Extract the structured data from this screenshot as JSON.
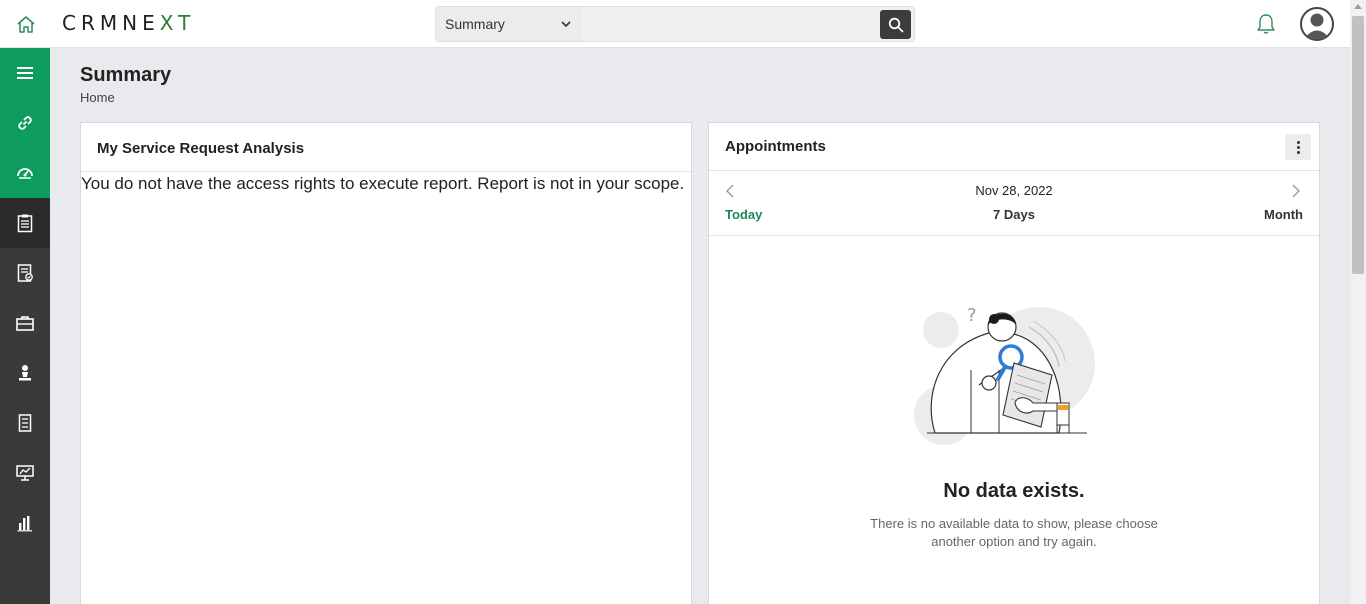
{
  "header": {
    "brand_left": "CRMNE",
    "brand_right": "XT",
    "search": {
      "selected_module": "Summary",
      "placeholder": ""
    }
  },
  "sidebar": {
    "items": [
      {
        "icon": "menu-icon"
      },
      {
        "icon": "link-icon"
      },
      {
        "icon": "dashboard-icon"
      },
      {
        "icon": "clipboard-icon"
      },
      {
        "icon": "report-list-icon"
      },
      {
        "icon": "briefcase-icon"
      },
      {
        "icon": "user-lamp-icon"
      },
      {
        "icon": "ledger-icon"
      },
      {
        "icon": "presentation-chart-icon"
      },
      {
        "icon": "bar-chart-icon"
      }
    ]
  },
  "page": {
    "title": "Summary",
    "breadcrumb": "Home"
  },
  "service_request_card": {
    "title": "My Service Request Analysis",
    "message": "You do not have the access rights to execute report. Report is not in your scope."
  },
  "appointments_card": {
    "title": "Appointments",
    "date": "Nov 28, 2022",
    "views": {
      "today": "Today",
      "week": "7 Days",
      "month": "Month"
    },
    "empty_title": "No data exists.",
    "empty_description": "There is no available data to show, please choose another option and try again."
  },
  "colors": {
    "accent_green": "#0d9b5e",
    "sidebar_dark": "#3a3a3a",
    "today_green": "#1a8a55",
    "magnifier_blue": "#2f7bd6"
  }
}
